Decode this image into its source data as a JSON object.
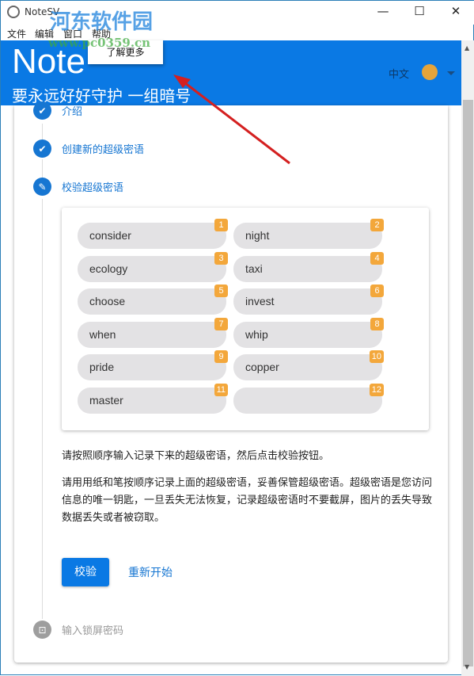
{
  "window": {
    "title": "NoteSV",
    "minimize": "—",
    "maximize": "☐",
    "close": "✕"
  },
  "menu": {
    "items": [
      "文件",
      "编辑",
      "窗口",
      "帮助"
    ],
    "dropdown": [
      "了解更多"
    ]
  },
  "header": {
    "brand": "Note",
    "slogan": "要永远好好守护 一组暗号",
    "language": "中文",
    "globe_icon": "globe-icon",
    "accent": "#0a79e4"
  },
  "steps": [
    {
      "label": "介绍",
      "status": "done"
    },
    {
      "label": "创建新的超级密语",
      "status": "done"
    },
    {
      "label": "校验超级密语",
      "status": "editing"
    },
    {
      "label": "输入锁屏密码",
      "status": "pending"
    }
  ],
  "words": [
    {
      "n": "1",
      "word": "consider"
    },
    {
      "n": "2",
      "word": "night"
    },
    {
      "n": "3",
      "word": "ecology"
    },
    {
      "n": "4",
      "word": "taxi"
    },
    {
      "n": "5",
      "word": "choose"
    },
    {
      "n": "6",
      "word": "invest"
    },
    {
      "n": "7",
      "word": "when"
    },
    {
      "n": "8",
      "word": "whip"
    },
    {
      "n": "9",
      "word": "pride"
    },
    {
      "n": "10",
      "word": "copper"
    },
    {
      "n": "11",
      "word": "master"
    },
    {
      "n": "12",
      "word": ""
    }
  ],
  "instructions": {
    "p1": "请按照顺序输入记录下来的超级密语，然后点击校验按钮。",
    "p2": "请用用纸和笔按顺序记录上面的超级密语，妥善保管超级密语。超级密语是您访问信息的唯一钥匙，一旦丢失无法恢复，记录超级密语时不要截屏，图片的丢失导致数据丢失或者被窃取。"
  },
  "actions": {
    "verify": "校验",
    "restart": "重新开始"
  },
  "watermark": {
    "name": "河东软件园",
    "url": "www.pc0359.cn"
  }
}
